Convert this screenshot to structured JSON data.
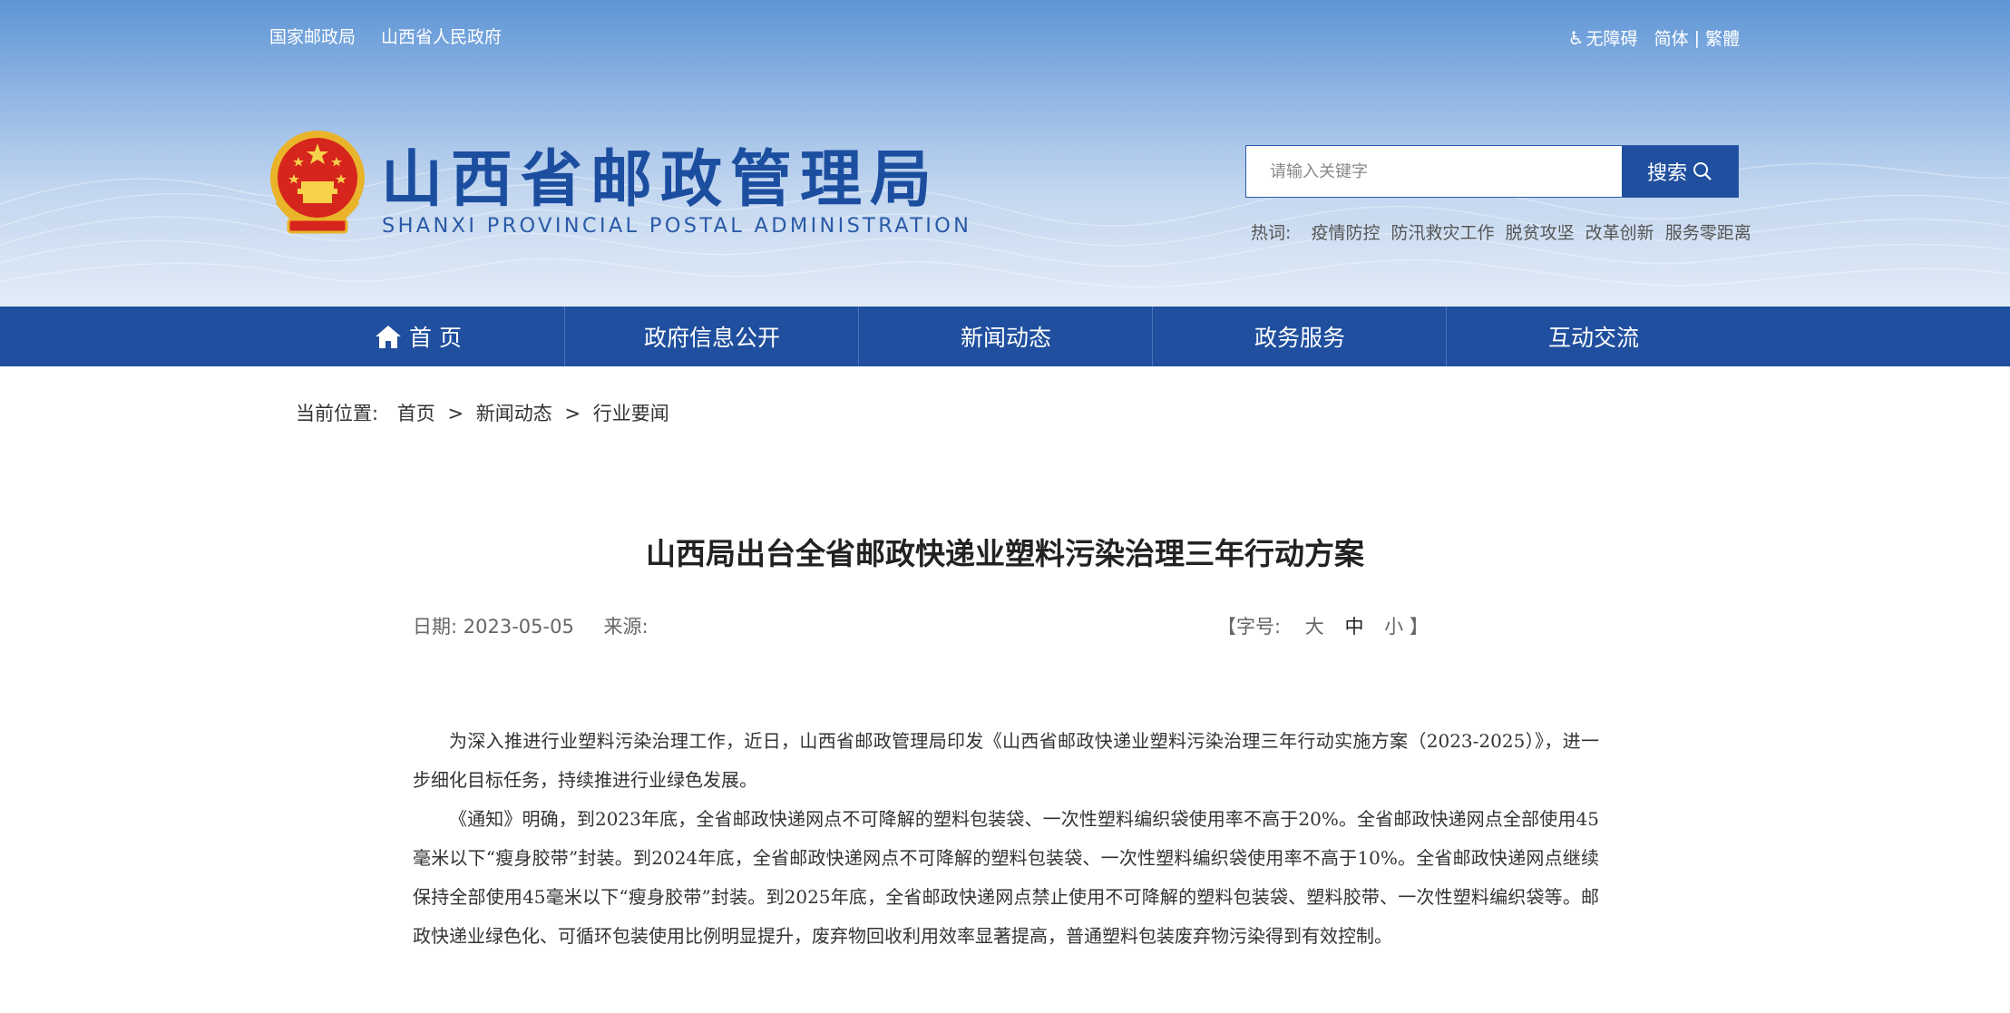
{
  "top_links": [
    "国家邮政局",
    "山西省人民政府"
  ],
  "top_right": {
    "accessibility": "无障碍",
    "simplified": "简体",
    "divider": "|",
    "traditional": "繁體"
  },
  "site": {
    "title_cn": "山西省邮政管理局",
    "title_en": "SHANXI PROVINCIAL POSTAL ADMINISTRATION"
  },
  "search": {
    "placeholder": "请输入关键字",
    "button_label": "搜索"
  },
  "hotwords": {
    "label": "热词:",
    "items": [
      "疫情防控",
      "防汛救灾工作",
      "脱贫攻坚",
      "改革创新",
      "服务零距离"
    ]
  },
  "nav": [
    "首 页",
    "政府信息公开",
    "新闻动态",
    "政务服务",
    "互动交流"
  ],
  "breadcrumb": {
    "label": "当前位置:",
    "items": [
      "首页",
      "新闻动态",
      "行业要闻"
    ],
    "separator": ">"
  },
  "article": {
    "title": "山西局出台全省邮政快递业塑料污染治理三年行动方案",
    "date_label": "日期:",
    "date": "2023-05-05",
    "source_label": "来源:",
    "fontsize": {
      "open": "【字号:",
      "large": "大",
      "medium": "中",
      "small": "小",
      "close": "】"
    },
    "paragraphs": [
      "为深入推进行业塑料污染治理工作，近日，山西省邮政管理局印发《山西省邮政快递业塑料污染治理三年行动实施方案（2023-2025）》，进一步细化目标任务，持续推进行业绿色发展。",
      "《通知》明确，到2023年底，全省邮政快递网点不可降解的塑料包装袋、一次性塑料编织袋使用率不高于20%。全省邮政快递网点全部使用45毫米以下“瘦身胶带”封装。到2024年底，全省邮政快递网点不可降解的塑料包装袋、一次性塑料编织袋使用率不高于10%。全省邮政快递网点继续保持全部使用45毫米以下“瘦身胶带”封装。到2025年底，全省邮政快递网点禁止使用不可降解的塑料包装袋、塑料胶带、一次性塑料编织袋等。邮政快递业绿色化、可循环包装使用比例明显提升，废弃物回收利用效率显著提高，普通塑料包装废弃物污染得到有效控制。"
    ]
  }
}
